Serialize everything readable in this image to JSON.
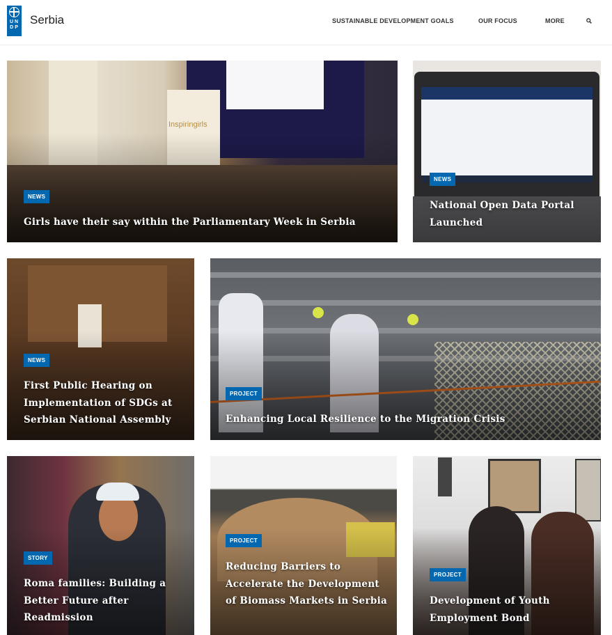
{
  "header": {
    "site_title": "Serbia",
    "logo_letters": [
      "U",
      "N",
      "D",
      "P"
    ],
    "nav": [
      {
        "label": "SUSTAINABLE DEVELOPMENT GOALS"
      },
      {
        "label": "OUR FOCUS"
      },
      {
        "label": "MORE"
      }
    ],
    "search_icon": "search-icon",
    "brand_color": "#0468b1"
  },
  "cards": [
    {
      "badge": "NEWS",
      "title": "Girls have their say within the Parliamentary Week in Serbia",
      "banner_text": "Inspiringirls"
    },
    {
      "badge": "NEWS",
      "title": "National Open Data Portal Launched"
    },
    {
      "badge": "NEWS",
      "title": "First Public Hearing on Implementation of SDGs at Serbian National Assembly"
    },
    {
      "badge": "PROJECT",
      "title": "Enhancing Local Resilience to the Migration Crisis"
    },
    {
      "badge": "STORY",
      "title": "Roma families: Building a Better Future after Readmission"
    },
    {
      "badge": "PROJECT",
      "title": "Reducing Barriers to Accelerate the Development of Biomass Markets in Serbia"
    },
    {
      "badge": "PROJECT",
      "title": "Development of Youth Employment Bond"
    }
  ]
}
